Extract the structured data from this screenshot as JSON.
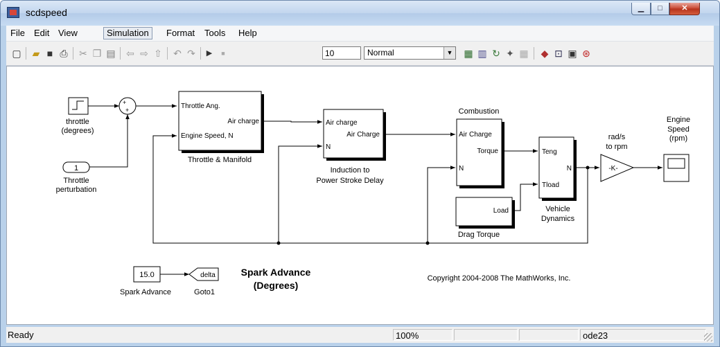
{
  "window": {
    "title": "scdspeed",
    "minimize_glyph": "▁",
    "maximize_glyph": "□",
    "close_glyph": "✕"
  },
  "menu": [
    "File",
    "Edit",
    "View",
    "Simulation",
    "Format",
    "Tools",
    "Help"
  ],
  "toolbar": {
    "stop_time": "10",
    "sim_mode": "Normal",
    "icons": [
      "new-model-icon",
      "open-icon",
      "save-icon",
      "print-icon",
      "cut-icon",
      "copy-icon",
      "paste-icon",
      "back-icon",
      "forward-icon",
      "up-icon",
      "undo-icon",
      "redo-icon",
      "start-simulation-icon",
      "stop-simulation-icon",
      "build-icon",
      "incremental-build-icon",
      "update-diagram-icon",
      "model-advisor-icon",
      "library-browser-icon",
      "model-explorer-icon",
      "debugger-icon",
      "block-reduction-icon",
      "signal-builder-icon"
    ]
  },
  "diagram": {
    "throttle_label_1": "throttle",
    "throttle_label_2": "(degrees)",
    "perturb_value": "1",
    "perturb_label_1": "Throttle",
    "perturb_label_2": "perturbation",
    "tm_in1": "Throttle Ang.",
    "tm_in2": "Engine Speed, N",
    "tm_out": "Air charge",
    "tm_label": "Throttle & Manifold",
    "ind_in1": "Air charge",
    "ind_in2": "N",
    "ind_out": "Air Charge",
    "ind_label_1": "Induction to",
    "ind_label_2": "Power Stroke Delay",
    "comb_title": "Combustion",
    "comb_in1": "Air Charge",
    "comb_in2": "N",
    "comb_out": "Torque",
    "drag_out": "Load",
    "drag_label": "Drag Torque",
    "veh_in1": "Teng",
    "veh_in2": "Tload",
    "veh_out": "N",
    "veh_label_1": "Vehicle",
    "veh_label_2": "Dynamics",
    "gain_title_1": "rad/s",
    "gain_title_2": "to rpm",
    "gain_text": "-K-",
    "scope_title_1": "Engine",
    "scope_title_2": "Speed",
    "scope_title_3": "(rpm)",
    "spark_value": "15.0",
    "spark_label": "Spark Advance",
    "goto_tag": "delta",
    "goto_label": "Goto1",
    "annotation_1": "Spark Advance",
    "annotation_2": "(Degrees)",
    "copyright": "Copyright 2004-2008 The MathWorks, Inc."
  },
  "status": {
    "ready": "Ready",
    "zoom": "100%",
    "solver": "ode23"
  }
}
